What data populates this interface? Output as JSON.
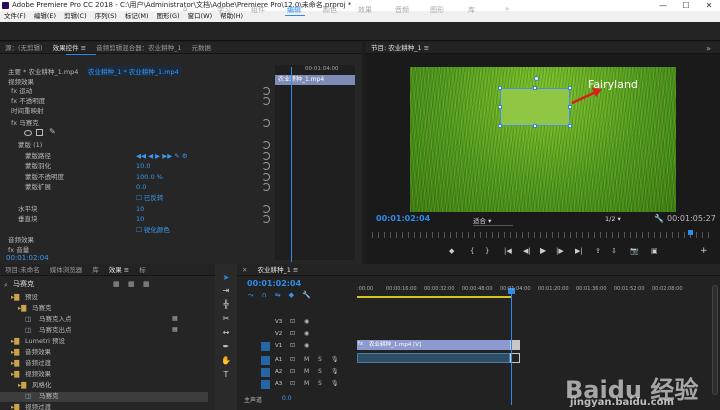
{
  "titlebar": {
    "title": "Adobe Premiere Pro CC 2018 - C:\\用户\\Administrator\\文档\\Adobe\\Premiere Pro\\12.0\\未命名.prproj *",
    "min": "—",
    "max": "☐",
    "close": "✕"
  },
  "menubar": [
    "文件(F)",
    "编辑(E)",
    "剪辑(C)",
    "序列(S)",
    "标记(M)",
    "图形(G)",
    "窗口(W)",
    "帮助(H)"
  ],
  "workspaces": {
    "home": "⌂",
    "items": [
      "学习",
      "组件",
      "编辑",
      "颜色",
      "效果",
      "音频",
      "图形",
      "库"
    ],
    "active": "编辑",
    "more": "»"
  },
  "effect_controls": {
    "tabs": [
      "源：(无剪辑)",
      "效果控件 ≡",
      "音频剪辑混合器：农业耕种_1",
      "元数据"
    ],
    "source": "主要 * 农业耕种_1.mp4",
    "sequence": "农业耕种_1 * 农业耕种_1.mp4",
    "mini_timecode": "00:01:04:00",
    "mini_clip": "农业耕种_1.mp4",
    "sections": {
      "video": "视频效果",
      "audio": "音频效果"
    },
    "rows": [
      {
        "label": "fx  运动",
        "indent": 1
      },
      {
        "label": "fx  不透明度",
        "indent": 1
      },
      {
        "label": "   时间重映射",
        "indent": 1
      },
      {
        "label": "fx  马赛克",
        "indent": 1
      },
      {
        "label": "蒙版 (1)",
        "indent": 2,
        "value": ""
      },
      {
        "label": "蒙版路径",
        "indent": 3,
        "value": "◀◀  ◀  ▶  ▶▶  ✎  ⚙"
      },
      {
        "label": "蒙版羽化",
        "indent": 3,
        "value": "10.0"
      },
      {
        "label": "蒙版不透明度",
        "indent": 3,
        "value": "100.0 %"
      },
      {
        "label": "蒙版扩展",
        "indent": 3,
        "value": "0.0"
      },
      {
        "label": "",
        "indent": 3,
        "value": "☐ 已反转"
      },
      {
        "label": "水平块",
        "indent": 2,
        "value": "10"
      },
      {
        "label": "垂直块",
        "indent": 2,
        "value": "10"
      },
      {
        "label": "",
        "indent": 2,
        "value": "☐ 锐化颜色"
      }
    ],
    "audio_rows": [
      "fx  音量"
    ],
    "timecode": "00:01:02:04"
  },
  "program": {
    "title": "节目: 农业耕种_1 ≡",
    "overlay_text": "Fairyland",
    "timecode": "00:01:02:04",
    "fit": "适合",
    "ratio": "1/2",
    "duration": "00:01:05:27"
  },
  "project": {
    "tabs": [
      "项目:未命名",
      "媒体浏览器",
      "库",
      "效果 ≡",
      "标"
    ],
    "search": "马赛克",
    "tree": [
      {
        "label": "预设",
        "indent": 1,
        "type": "folder"
      },
      {
        "label": "马赛克",
        "indent": 2,
        "type": "folder"
      },
      {
        "label": "马赛克入点",
        "indent": 3,
        "type": "fx"
      },
      {
        "label": "马赛克出点",
        "indent": 3,
        "type": "fx"
      },
      {
        "label": "Lumetri 预设",
        "indent": 1,
        "type": "folder"
      },
      {
        "label": "音频效果",
        "indent": 1,
        "type": "folder"
      },
      {
        "label": "音频过渡",
        "indent": 1,
        "type": "folder"
      },
      {
        "label": "视频效果",
        "indent": 1,
        "type": "folder"
      },
      {
        "label": "风格化",
        "indent": 2,
        "type": "folder"
      },
      {
        "label": "马赛克",
        "indent": 3,
        "type": "fx",
        "selected": true
      },
      {
        "label": "视频过渡",
        "indent": 1,
        "type": "folder"
      }
    ]
  },
  "timeline": {
    "tab": "农业耕种_1 ≡",
    "timecode": "00:01:02:04",
    "ruler": [
      ":00:00",
      "00:00:16:00",
      "00:00:32:00",
      "00:00:48:00",
      "00:01:04:00",
      "00:01:20:00",
      "00:01:36:00",
      "00:01:52:00",
      "00:02:08:00"
    ],
    "tracks": [
      {
        "name": "V3"
      },
      {
        "name": "V2"
      },
      {
        "name": "V1"
      },
      {
        "name": "A1"
      },
      {
        "name": "A2"
      },
      {
        "name": "A3"
      }
    ],
    "master": "主声道",
    "master_value": "0.0",
    "video_clip": "农业耕种_1.mp4 [V]"
  },
  "watermark": {
    "text": "Baidu 经验",
    "url": "jingyan.baidu.com"
  },
  "colors": {
    "accent": "#2d8ceb",
    "clip_video": "#8c9ad0",
    "clip_audio": "#2c4e66"
  }
}
